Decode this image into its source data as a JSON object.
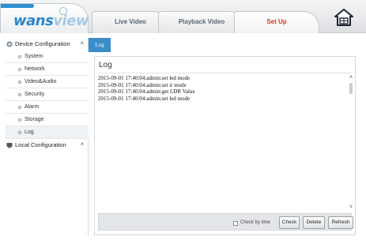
{
  "brand": {
    "logo_main": "wans",
    "logo_dim": "view"
  },
  "nav": {
    "tabs": [
      {
        "label": "Live Video"
      },
      {
        "label": "Playback Video"
      },
      {
        "label": "Set Up"
      }
    ],
    "active_tab": "Set Up",
    "home_icon": "home-icon"
  },
  "sidebar": {
    "device_config": {
      "label": "Device Configuration",
      "expanded": true,
      "items": [
        "System",
        "Network",
        "Video&Audio",
        "Security",
        "Alarm",
        "Storage",
        "Log"
      ],
      "selected": "Log"
    },
    "local_config": {
      "label": "Local Configuration",
      "expanded": true
    }
  },
  "content": {
    "tab_label": "Log",
    "title": "Log",
    "log_lines": [
      "2015-09-01 17:40:04:admin:set led mode",
      "2015-09-01 17:40:04:admin:set ir mode",
      "2015-09-01 17:40:04:admin:get LDR Value",
      "2015-09-01 17:40:04:admin:set led mode"
    ],
    "footer": {
      "check_by_time_label": "Check by time",
      "check_by_time_checked": false,
      "check_button": "Check",
      "delete_button": "Delete",
      "refresh_button": "Refresh"
    }
  },
  "colors": {
    "accent_blue": "#3c8dc6",
    "active_tab_text": "#d0342c",
    "logo_blue": "#2d85c8"
  }
}
